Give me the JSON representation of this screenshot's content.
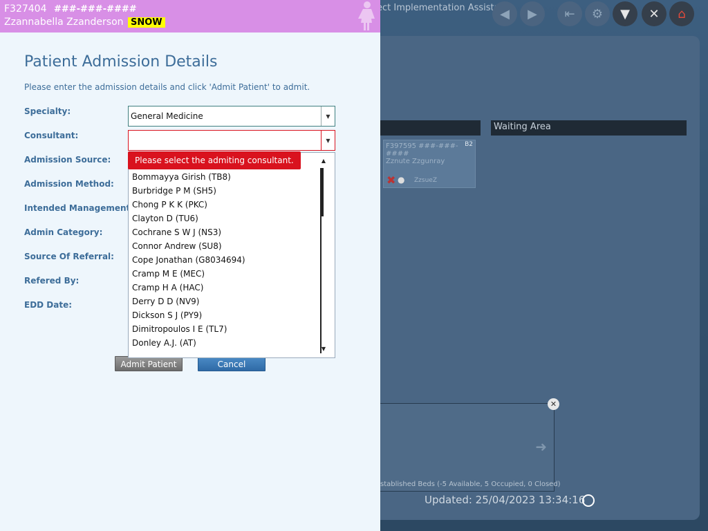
{
  "background": {
    "header_title": "ect Implementation Assistant",
    "toolbar_icons": [
      "back-arrow-icon",
      "forward-arrow-icon",
      "exit-icon",
      "settings-icon",
      "filter-icon",
      "close-icon",
      "home-icon"
    ],
    "column_headers": [
      "Waiting Area"
    ],
    "bed_card": {
      "patient_id": "F397595",
      "nhs_mask": "###-###-####",
      "name": "Zznute Zzgunray",
      "bed_number": "B2",
      "user": "ZzsueZ"
    },
    "beds_summary": "stablished Beds (-5 Available, 5 Occupied, 0 Closed)",
    "updated": "Updated: 25/04/2023 13:34:16"
  },
  "patient": {
    "id": "F327404",
    "nhs_mask": "###-###-####",
    "name": "Zzannabella Zzanderson",
    "alert": "SNOW"
  },
  "form": {
    "title": "Patient Admission Details",
    "instruction": "Please enter the admission details and click 'Admit Patient' to admit.",
    "labels": {
      "specialty": "Specialty:",
      "consultant": "Consultant:",
      "admission_source": "Admission Source:",
      "admission_method": "Admission Method:",
      "intended_management": "Intended Management:",
      "admin_category": "Admin Category:",
      "source_of_referral": "Source Of Referral:",
      "refered_by": "Refered By:",
      "edd_date": "EDD Date:"
    },
    "specialty_value": "General Medicine",
    "consultant_value": "",
    "consultant_error": "Please select the admiting consultant.",
    "consultant_options": [
      "Bommayya Girish (TB8)",
      "Burbridge P M (SH5)",
      "Chong P K K (PKC)",
      "Clayton D (TU6)",
      "Cochrane S W J (NS3)",
      "Connor Andrew (SU8)",
      "Cope Jonathan (G8034694)",
      "Cramp M E (MEC)",
      "Cramp H A (HAC)",
      "Derry D D (NV9)",
      "Dickson S J (PY9)",
      "Dimitropoulos I E (TL7)",
      "Donley A.J. (AT)"
    ],
    "admit_label": "Admit Patient",
    "cancel_label": "Cancel"
  }
}
